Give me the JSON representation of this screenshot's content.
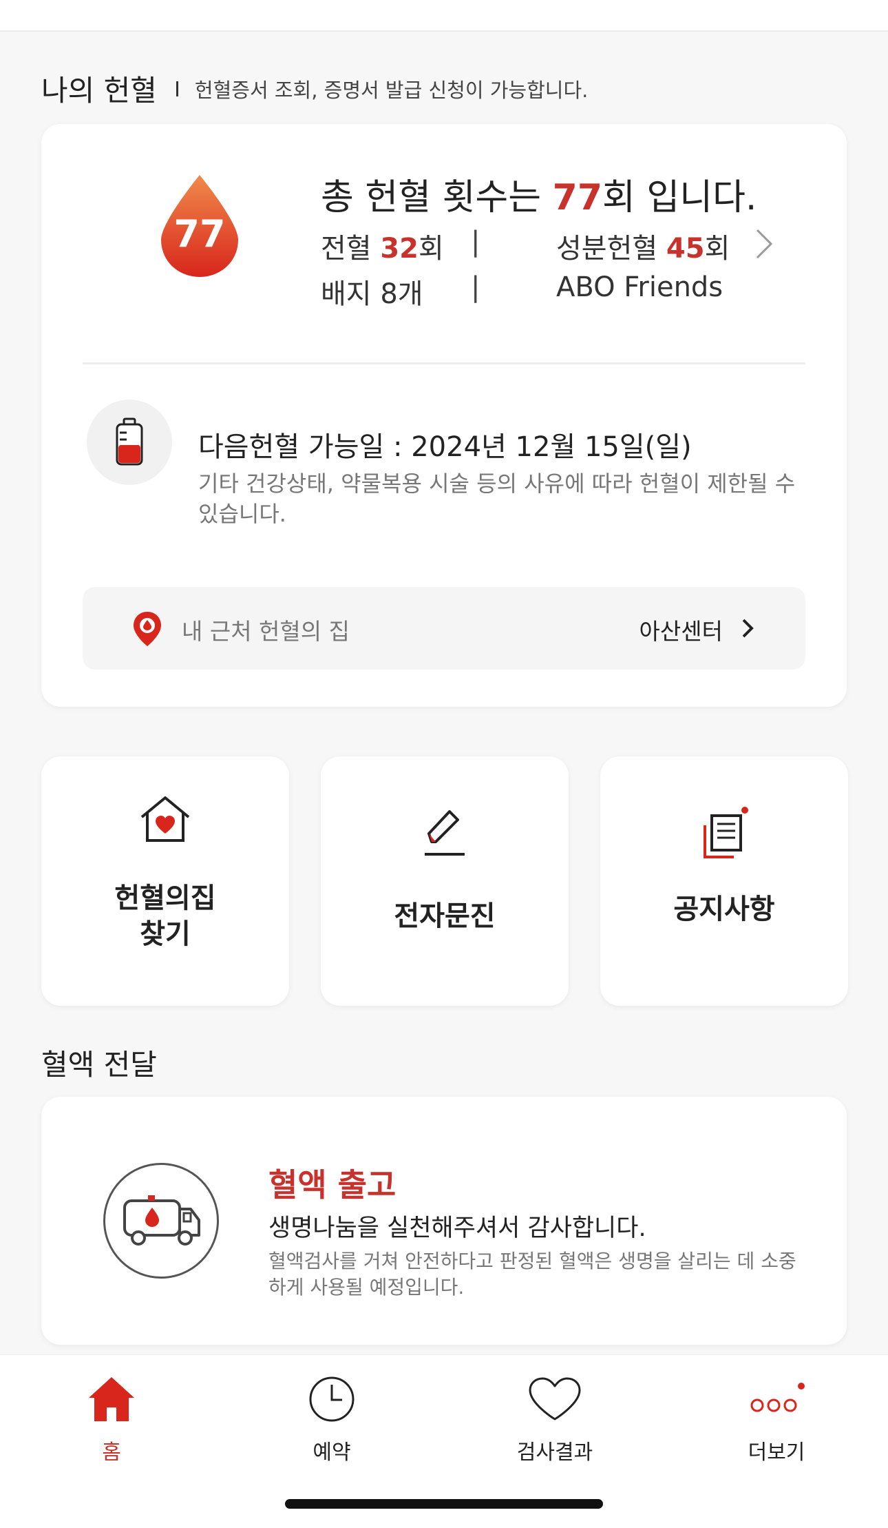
{
  "section": {
    "title": "나의 헌혈",
    "description": "헌혈증서 조회, 증명서 발급 신청이 가능합니다."
  },
  "summary": {
    "drop_number": "77",
    "total_prefix": "총 헌혈 횟수는 ",
    "total_count": "77",
    "total_suffix": "회 입니다.",
    "whole_label": "전혈 ",
    "whole_count": "32",
    "whole_unit": "회",
    "component_label": "성분헌혈 ",
    "component_count": "45",
    "component_unit": "회",
    "badge_text": "배지 8개",
    "separator": "|",
    "group_text": "ABO Friends"
  },
  "next": {
    "date_text": "다음헌혈 가능일 : 2024년 12월 15일(일)",
    "note": "기타 건강상태, 약물복용 시술 등의 사유에 따라 헌혈이 제한될 수 있습니다."
  },
  "nearby": {
    "label": "내 근처 헌혈의 집",
    "center": "아산센터"
  },
  "tiles": [
    {
      "label": "헌혈의집\n찾기",
      "icon": "house-heart-icon"
    },
    {
      "label": "전자문진",
      "icon": "pen-icon"
    },
    {
      "label": "공지사항",
      "icon": "notice-icon"
    }
  ],
  "delivery": {
    "section_title": "혈액 전달",
    "title": "혈액 출고",
    "subtitle": "생명나눔을 실천해주셔서 감사합니다.",
    "note": "혈액검사를 거쳐 안전하다고 판정된 혈액은 생명을 살리는 데 소중하게 사용될 예정입니다."
  },
  "nav": [
    {
      "label": "홈",
      "icon": "home-icon",
      "active": true
    },
    {
      "label": "예약",
      "icon": "clock-icon",
      "active": false
    },
    {
      "label": "검사결과",
      "icon": "heart-icon",
      "active": false
    },
    {
      "label": "더보기",
      "icon": "more-icon",
      "active": false
    }
  ],
  "colors": {
    "accent": "#c8322d",
    "background": "#f7f7f7",
    "card": "#ffffff"
  }
}
